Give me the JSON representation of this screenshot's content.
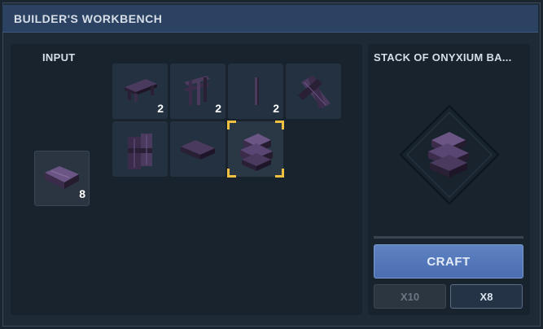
{
  "window": {
    "title": "BUILDER'S WORKBENCH"
  },
  "input": {
    "label": "INPUT",
    "item": {
      "name": "onyxium-bar",
      "count": "8"
    }
  },
  "recipes": [
    {
      "name": "onyxium-bench-recipe",
      "count": "2"
    },
    {
      "name": "onyxium-fence-recipe",
      "count": "2"
    },
    {
      "name": "onyxium-post-recipe",
      "count": "2"
    },
    {
      "name": "onyxium-beam-cross-recipe",
      "count": ""
    },
    {
      "name": "onyxium-door-recipe",
      "count": ""
    },
    {
      "name": "onyxium-bar-recipe",
      "count": ""
    },
    {
      "name": "stack-of-onyxium-bars-recipe",
      "count": "",
      "selected": true
    }
  ],
  "output": {
    "title": "STACK OF ONYXIUM BA..."
  },
  "actions": {
    "craft_label": "CRAFT",
    "x10_label": "X10",
    "x8_label": "X8"
  },
  "colors": {
    "accent": "#5e82c2",
    "selection": "#f0c040",
    "item_purple": "#4a3a5e"
  }
}
